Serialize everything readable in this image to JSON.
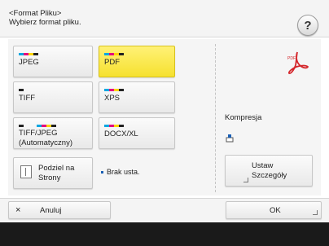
{
  "header": {
    "title": "<Format Pliku>",
    "subtitle": "Wybierz format pliku.",
    "help_label": "?"
  },
  "formats": {
    "jpeg": "JPEG",
    "pdf": "PDF",
    "tiff": "TIFF",
    "xps": "XPS",
    "tiffjpeg_line1": "TIFF/JPEG",
    "tiffjpeg_line2": "(Automatyczny)",
    "docx": "DOCX/XL"
  },
  "selected_format": "PDF",
  "split": {
    "line1": "Podziel na",
    "line2": "Strony",
    "status": "Brak usta."
  },
  "compression": {
    "label": "Kompresja"
  },
  "details": {
    "line1": "Ustaw",
    "line2": "Szczegóły"
  },
  "footer": {
    "cancel_icon": "×",
    "cancel": "Anuluj",
    "ok": "OK"
  },
  "colors": {
    "selected": "#f6e12f",
    "pdf_red": "#d4262b",
    "accent_blue": "#1a5fb4"
  },
  "icons": [
    "help-icon",
    "pdf-icon",
    "split-pages-icon",
    "compression-icon",
    "close-icon",
    "return-icon"
  ]
}
